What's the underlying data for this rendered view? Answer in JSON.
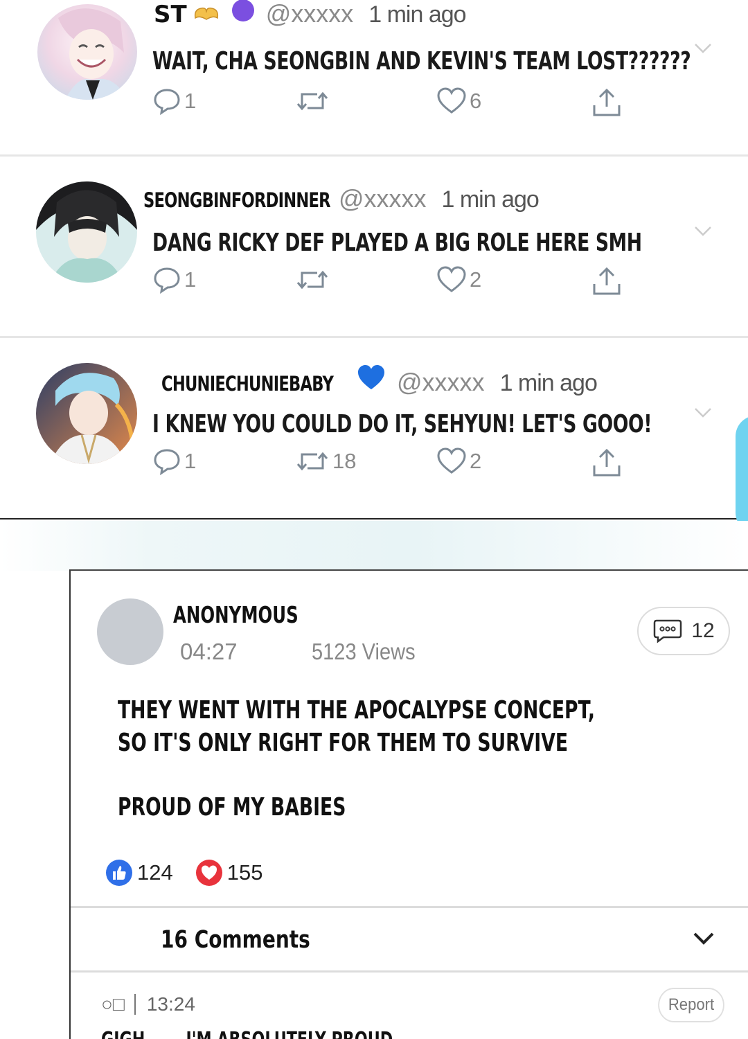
{
  "tweets": [
    {
      "display_name": "ST",
      "handle": "@xxxxx",
      "time": "1 min ago",
      "text": "WAIT, CHA SEONGBIN AND KEVIN'S TEAM LOST??????",
      "replies": "1",
      "retweets": "",
      "likes": "6",
      "badges": [
        "hands-heart-emoji",
        "purple-circle-emoji"
      ]
    },
    {
      "display_name": "SEONGBINFORDINNER",
      "handle": "@xxxxx",
      "time": "1 min ago",
      "text": "DANG RICKY DEF PLAYED A BIG ROLE HERE SMH",
      "replies": "1",
      "retweets": "",
      "likes": "2",
      "badges": []
    },
    {
      "display_name": "CHUNIECHUNIEBABY",
      "handle": "@xxxxx",
      "time": "1 min ago",
      "text": "I KNEW YOU COULD DO IT, SEHYUN! LET'S GOOO!",
      "replies": "1",
      "retweets": "18",
      "likes": "2",
      "badges": [
        "blue-heart-emoji"
      ]
    }
  ],
  "post": {
    "author": "ANONYMOUS",
    "time": "04:27",
    "views": "5123 Views",
    "comment_count": "12",
    "body_line1": "THEY WENT WITH THE APOCALYPSE CONCEPT,",
    "body_line2": "SO IT'S ONLY RIGHT FOR THEM TO SURVIVE",
    "body_line3": "PROUD OF MY BABIES",
    "thumbs_up": "124",
    "hearts": "155",
    "comments_label": "16 Comments"
  },
  "first_comment": {
    "author": "○□",
    "time": "13:24",
    "report_label": "Report",
    "name_cut": "GIGH",
    "text_cut": "I'M ABSOLUTELY PROUD"
  },
  "colors": {
    "purple_badge": "#7b4fe0",
    "blue_heart": "#1e6fe0",
    "thumbs_blue": "#2f6fe8",
    "heart_red": "#e8333c",
    "meta_gray": "#8a8a8a"
  }
}
